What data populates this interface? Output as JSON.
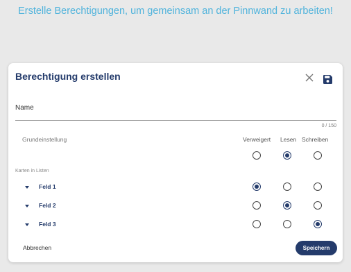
{
  "banner": "Erstelle Berechtigungen, um gemeinsam an der Pinnwand zu arbeiten!",
  "dialog": {
    "title": "Berechtigung erstellen",
    "close_icon": "close-icon",
    "save_icon": "floppy-disk-icon",
    "name_label": "Name",
    "name_value": "",
    "counter": "0 / 150",
    "columns": [
      "Verweigert",
      "Lesen",
      "Schreiben"
    ],
    "default_label": "Grundeinstellung",
    "default_selection": "Lesen",
    "section_label": "Karten in Listen",
    "rows": [
      {
        "label": "Feld 1",
        "selection": "Verweigert"
      },
      {
        "label": "Feld 2",
        "selection": "Lesen"
      },
      {
        "label": "Feld 3",
        "selection": "Schreiben"
      }
    ],
    "cancel_label": "Abbrechen",
    "save_label": "Speichern"
  },
  "colors": {
    "banner_text": "#4fb3dc",
    "accent": "#243b6b",
    "background": "#e9e9e9"
  }
}
